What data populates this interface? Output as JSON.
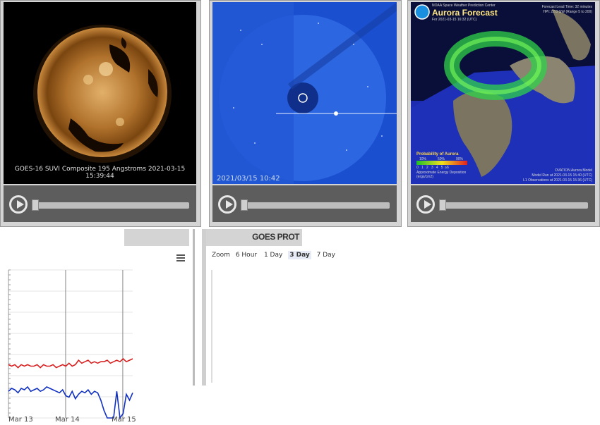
{
  "panels": {
    "suvi": {
      "caption": "GOES-16 SUVI Composite 195 Angstroms 2021-03-15 15:39:44"
    },
    "lasco": {
      "timestamp": "2021/03/15 10:42"
    },
    "aurora": {
      "org": "NOAA Space Weather Prediction Center",
      "title": "Aurora Forecast",
      "subtitle": "For 2021-03-15 16:32 (UTC)",
      "lead_time": "Forecast Lead Time: 32 minutes",
      "hpi": "HPI: 22.0 GW (Range 5 to 200)",
      "legend_title": "Probability of Aurora",
      "legend_pct": [
        "10%",
        "50%",
        "90%"
      ],
      "legend_ticks": "0   1   2   3   4   5  ≥6",
      "legend_note": "Approximate Energy Deposition (ergs/cm2)",
      "model": "OVATION Aurora Model",
      "model_run": "Model Run at 2021-03-15 15:40 (UTC)",
      "l1_obs": "L1 Observations at 2021-03-15 15:36 (UTC)"
    }
  },
  "chart": {
    "x_labels": [
      "Mar 13",
      "Mar 14",
      "Mar 15"
    ]
  },
  "goes": {
    "header": "GOES PROT",
    "zoom_label": "Zoom",
    "zoom_options": [
      "6 Hour",
      "1 Day",
      "3 Day",
      "7 Day"
    ],
    "zoom_selected": "3 Day"
  },
  "chart_data": {
    "type": "line",
    "x": [
      "Mar 13",
      "Mar 14",
      "Mar 15"
    ],
    "series": [
      {
        "color": "#d62020",
        "values": [
          0.36,
          0.35,
          0.36,
          0.34,
          0.36,
          0.35,
          0.36,
          0.35,
          0.35,
          0.36,
          0.34,
          0.36,
          0.35,
          0.35,
          0.36,
          0.34,
          0.35,
          0.36,
          0.35,
          0.37,
          0.35,
          0.36,
          0.39,
          0.37,
          0.38,
          0.39,
          0.37,
          0.38,
          0.37,
          0.38,
          0.38,
          0.39,
          0.37,
          0.38,
          0.39,
          0.38,
          0.4,
          0.38,
          0.39,
          0.4
        ]
      },
      {
        "color": "#1030c0",
        "values": [
          0.18,
          0.2,
          0.19,
          0.17,
          0.2,
          0.19,
          0.21,
          0.18,
          0.19,
          0.2,
          0.18,
          0.19,
          0.21,
          0.2,
          0.19,
          0.18,
          0.17,
          0.19,
          0.15,
          0.14,
          0.18,
          0.13,
          0.16,
          0.18,
          0.17,
          0.19,
          0.16,
          0.18,
          0.17,
          0.12,
          0.05,
          0.0,
          0.0,
          0.0,
          0.18,
          0.0,
          0.03,
          0.16,
          0.12,
          0.17
        ]
      }
    ],
    "grid": true,
    "legend": "none"
  }
}
